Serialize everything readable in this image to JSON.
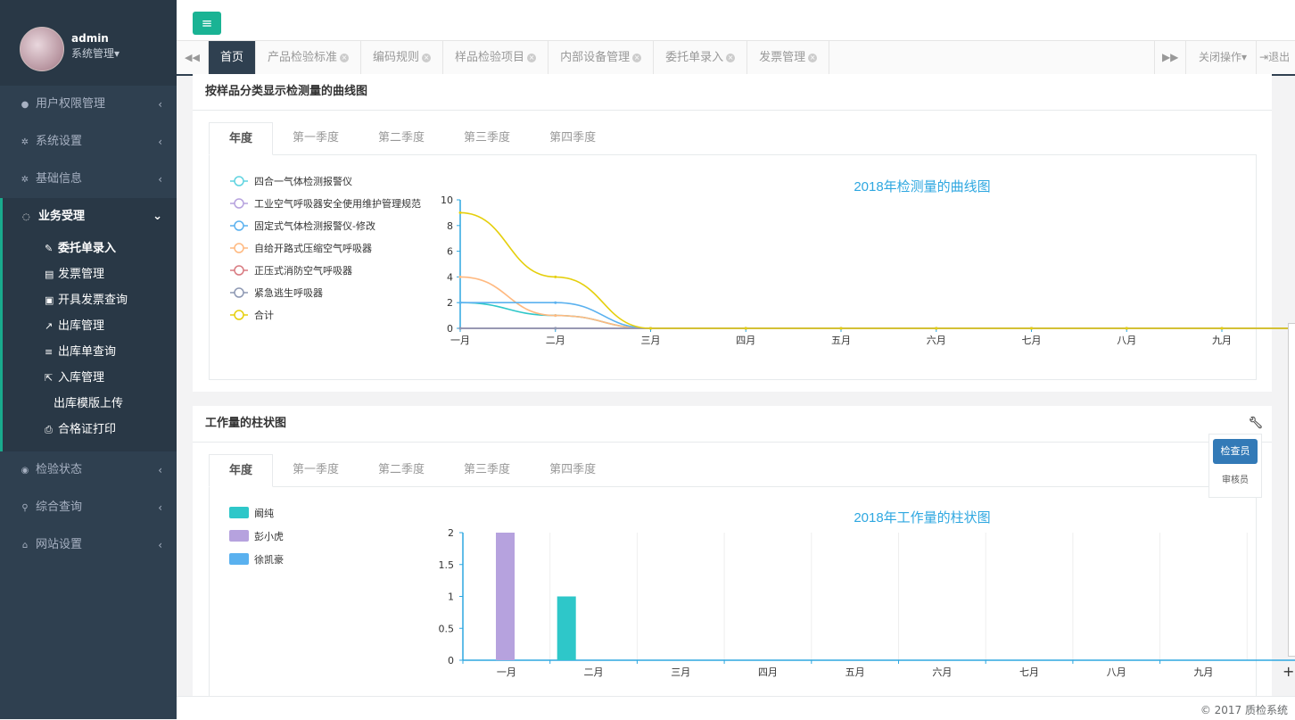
{
  "sidebar": {
    "user": {
      "name": "admin",
      "role": "系统管理"
    },
    "items": [
      {
        "label": "用户权限管理",
        "icon": "user-icon"
      },
      {
        "label": "系统设置",
        "icon": "gear-icon"
      },
      {
        "label": "基础信息",
        "icon": "gear-icon"
      }
    ],
    "active": {
      "label": "业务受理",
      "icon": "comments-icon",
      "sub": [
        {
          "label": "委托单录入",
          "icon": "edit-icon"
        },
        {
          "label": "发票管理",
          "icon": "file-icon"
        },
        {
          "label": "开具发票查询",
          "icon": "image-icon"
        },
        {
          "label": "出库管理",
          "icon": "external-link-icon"
        },
        {
          "label": "出库单查询",
          "icon": "list-icon"
        },
        {
          "label": "入库管理",
          "icon": "share-icon"
        },
        {
          "label": "出库模版上传",
          "icon": ""
        },
        {
          "label": "合格证打印",
          "icon": "print-icon"
        }
      ]
    },
    "items_after": [
      {
        "label": "检验状态",
        "icon": "chrome-icon"
      },
      {
        "label": "综合查询",
        "icon": "search-icon"
      },
      {
        "label": "网站设置",
        "icon": "home-icon"
      }
    ]
  },
  "tabs": [
    "首页",
    "产品检验标准",
    "编码规则",
    "样品检验项目",
    "内部设备管理",
    "委托单录入",
    "发票管理"
  ],
  "tabs_right": {
    "close_ops": "关闭操作",
    "logout": "退出"
  },
  "line_panel": {
    "title": "按样品分类显示检测量的曲线图",
    "tabs": [
      "年度",
      "第一季度",
      "第二季度",
      "第三季度",
      "第四季度"
    ]
  },
  "bar_panel": {
    "title": "工作量的柱状图",
    "tabs": [
      "年度",
      "第一季度",
      "第二季度",
      "第三季度",
      "第四季度"
    ]
  },
  "floating": {
    "button": "检查员",
    "item": "审核员"
  },
  "footer": "© 2017 质检系统",
  "chart_data": [
    {
      "type": "line",
      "title": "2018年检测量的曲线图",
      "categories": [
        "一月",
        "二月",
        "三月",
        "四月",
        "五月",
        "六月",
        "七月",
        "八月",
        "九月"
      ],
      "ylim": [
        0,
        10
      ],
      "yticks": [
        0,
        2,
        4,
        6,
        8,
        10
      ],
      "legend_position": "left",
      "series": [
        {
          "name": "四合一气体检测报警仪",
          "color": "#5fd3e0",
          "values": [
            0,
            0,
            0,
            0,
            0,
            0,
            0,
            0,
            0
          ]
        },
        {
          "name": "工业空气呼吸器安全使用维护管理规范",
          "color": "#b6a2de",
          "values": [
            0,
            0,
            0,
            0,
            0,
            0,
            0,
            0,
            0
          ]
        },
        {
          "name": "固定式气体检测报警仪-修改",
          "color": "#5ab1ef",
          "values": [
            2,
            2,
            0,
            0,
            0,
            0,
            0,
            0,
            0
          ]
        },
        {
          "name": "自给开路式压缩空气呼吸器",
          "color": "#ffb980",
          "values": [
            4,
            1,
            0,
            0,
            0,
            0,
            0,
            0,
            0
          ]
        },
        {
          "name": "正压式消防空气呼吸器",
          "color": "#d87a80",
          "values": [
            0,
            0,
            0,
            0,
            0,
            0,
            0,
            0,
            0
          ]
        },
        {
          "name": "紧急逃生呼吸器",
          "color": "#8d98b3",
          "values": [
            0,
            0,
            0,
            0,
            0,
            0,
            0,
            0,
            0
          ]
        },
        {
          "name": "合计",
          "color": "#e5cf0d",
          "values": [
            9,
            4,
            0,
            0,
            0,
            0,
            0,
            0,
            0
          ]
        },
        {
          "name": "",
          "color": "#2ec7c9",
          "values": [
            2,
            1,
            0,
            0,
            0,
            0,
            0,
            0,
            0
          ]
        }
      ]
    },
    {
      "type": "bar",
      "title": "2018年工作量的柱状图",
      "categories": [
        "一月",
        "二月",
        "三月",
        "四月",
        "五月",
        "六月",
        "七月",
        "八月",
        "九月"
      ],
      "ylim": [
        0,
        2
      ],
      "yticks": [
        0,
        0.5,
        1,
        1.5,
        2
      ],
      "legend_position": "left",
      "series": [
        {
          "name": "阚纯",
          "color": "#2ec7c9",
          "values": [
            0,
            1,
            0,
            0,
            0,
            0,
            0,
            0,
            0
          ]
        },
        {
          "name": "彭小虎",
          "color": "#b6a2de",
          "values": [
            2,
            0,
            0,
            0,
            0,
            0,
            0,
            0,
            0
          ]
        },
        {
          "name": "徐凯豪",
          "color": "#5ab1ef",
          "values": [
            0,
            0,
            0,
            0,
            0,
            0,
            0,
            0,
            0
          ]
        }
      ]
    }
  ]
}
